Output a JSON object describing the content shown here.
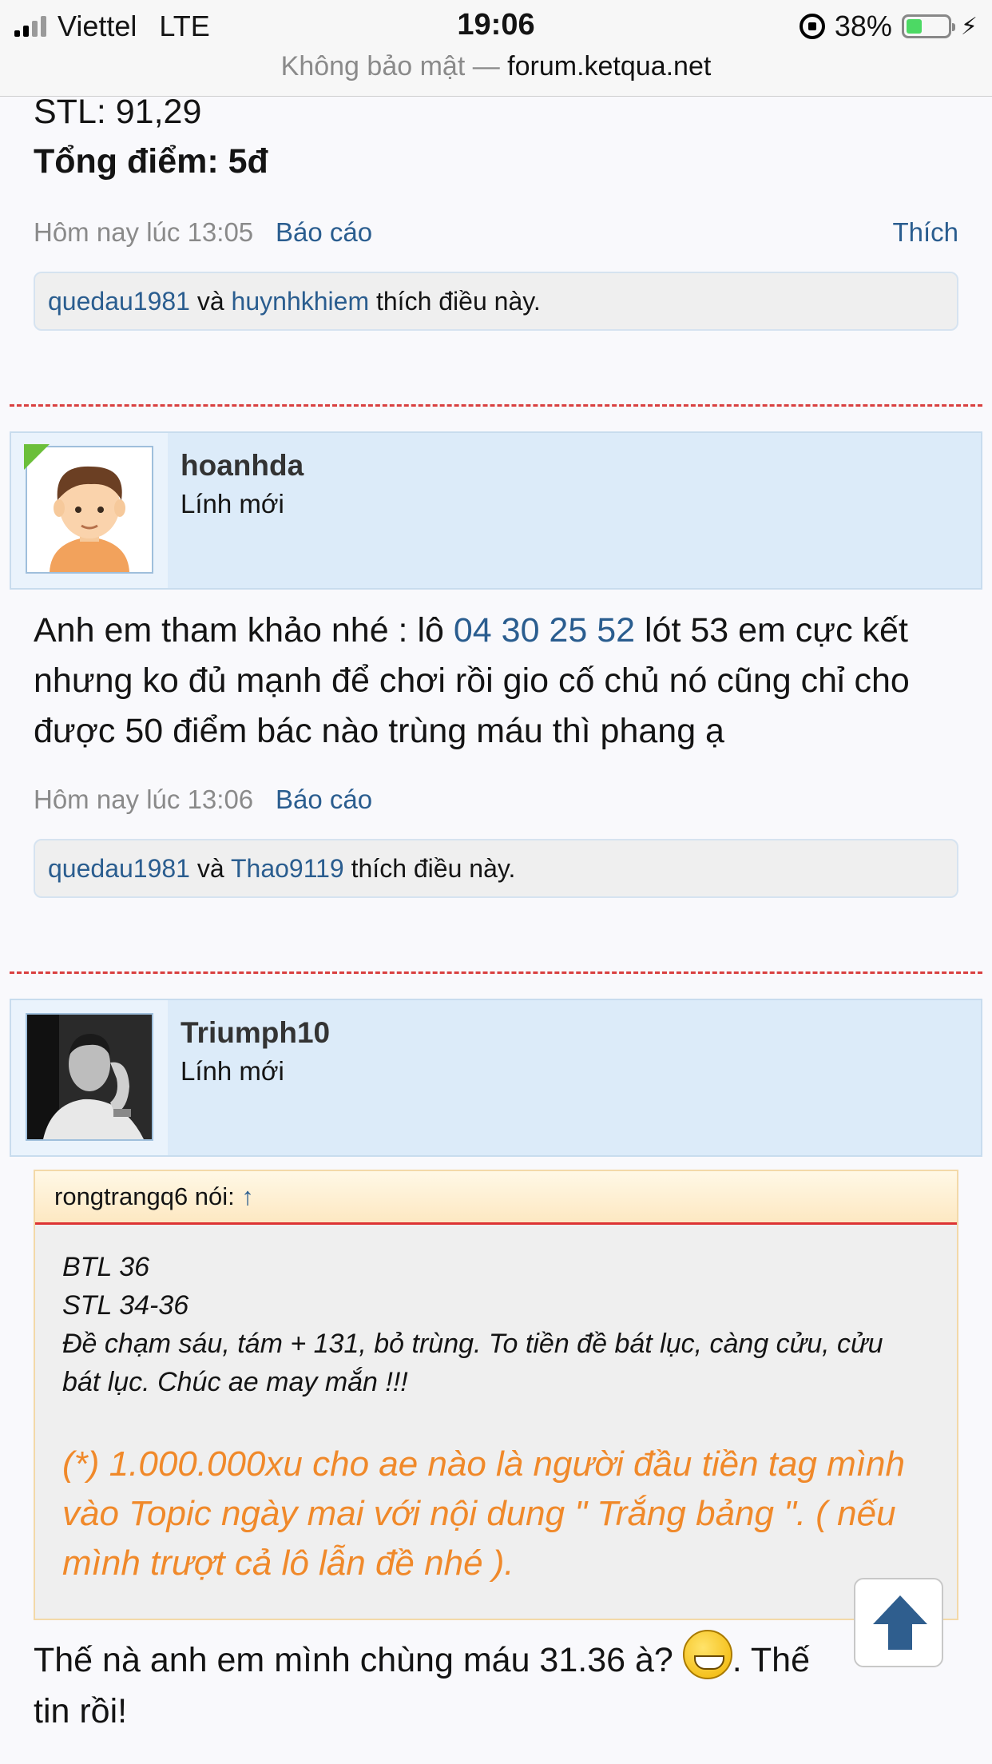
{
  "status_bar": {
    "carrier": "Viettel",
    "network": "LTE",
    "time": "19:06",
    "battery_pct": "38%",
    "battery_level": 0.38
  },
  "url_bar": {
    "security": "Không bảo mật —",
    "host": "forum.ketqua.net"
  },
  "post1": {
    "line1": "STL: 91,29",
    "line2": "Tổng điểm: 5đ",
    "timestamp": "Hôm nay lúc 13:05",
    "report": "Báo cáo",
    "like": "Thích",
    "likers": [
      "quedau1981",
      "huynhkhiem"
    ],
    "likes_and": "và",
    "likes_suffix": "thích điều này."
  },
  "post2": {
    "username": "hoanhda",
    "user_title": "Lính mới",
    "text_a": "Anh em tham khảo nhé : lô ",
    "text_numbers": "04 30 25 52",
    "text_b": " lót 53 em cực kết",
    "text_line2": "nhưng ko đủ mạnh để chơi rồi gio cố chủ nó cũng chỉ cho",
    "text_line3": "được 50 điểm bác nào trùng máu thì phang ạ",
    "timestamp": "Hôm nay lúc 13:06",
    "report": "Báo cáo",
    "likers": [
      "quedau1981",
      "Thao9119"
    ],
    "likes_and": "và",
    "likes_suffix": "thích điều này."
  },
  "post3": {
    "username": "Triumph10",
    "user_title": "Lính mới",
    "quote_author": "rongtrangq6 nói:",
    "quote_arrow": "↑",
    "quote_lines": [
      "BTL 36",
      "STL 34-36",
      "Đề chạm sáu, tám + 131, bỏ trùng. To tiền đề bát lục, càng cửu, cửu",
      "bát lục. Chúc ae may mắn !!!"
    ],
    "quote_highlight": [
      "(*) 1.000.000xu cho ae nào là người đầu tiền tag mình",
      "vào Topic ngày mai với nội dung \" Trắng bảng \". ( nếu",
      "mình trượt cả lô lẫn đề nhé )."
    ],
    "reply_a": "Thế nà anh em mình chùng máu 31.36 à?",
    "reply_b": ". Thế",
    "reply_line2": "tin rồi!"
  },
  "icons": {
    "scroll_top": "arrow-up-icon",
    "emoji": "grin-emoji-icon"
  }
}
